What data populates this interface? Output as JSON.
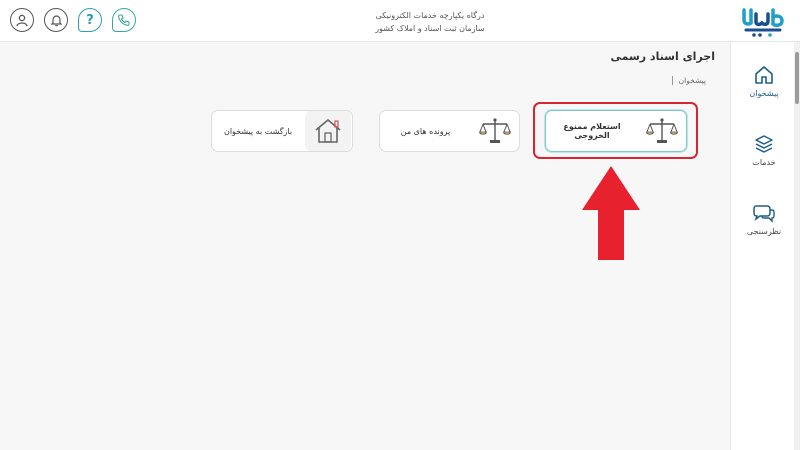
{
  "header": {
    "title_line1": "درگاه یکپارچه خدمات الکترونیکی",
    "title_line2": "سازمان ثبت اسناد و املاک کشور",
    "help_label": "?"
  },
  "sidebar": {
    "items": [
      {
        "label": "پیشخوان",
        "active": true
      },
      {
        "label": "خدمات"
      },
      {
        "label": "نظرسنجی"
      }
    ]
  },
  "main": {
    "page_title": "اجرای اسناد رسمی",
    "breadcrumb": "پیشخوان",
    "cards": [
      {
        "label": "استعلام ممنوع الخروجی",
        "icon": "scales-icon",
        "highlighted": true
      },
      {
        "label": "پرونده های من",
        "icon": "scales-icon"
      },
      {
        "label": "بازگشت به پیشخوان",
        "icon": "home-icon"
      }
    ]
  },
  "colors": {
    "annotation_red": "#d92432",
    "accent_teal": "#3aa8a0",
    "highlight_border": "#7fc9c8"
  }
}
